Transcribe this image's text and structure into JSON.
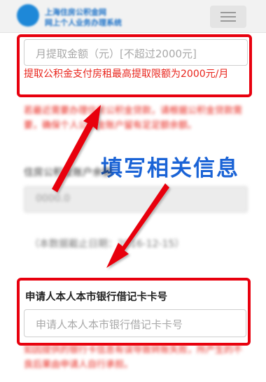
{
  "header": {
    "title_line1": "上海住房公积金网",
    "title_line2": "网上个人业务办理系统"
  },
  "monthly_amount": {
    "placeholder": "月提取金额（元）[不超过2000元]",
    "note": "提取公积金支付房租最高提取限额为2000元/月"
  },
  "blurred_warning": "若最近需要办理住房公积金贷款，请根据公积金贷款需要，确保个人公积金账户留有足足额余额。",
  "callout_text": "填写相关信息",
  "account_label": "住房公积金账户余额",
  "account_value": "0000.0",
  "account_date": "（本数据截止日期：2016-12-15）",
  "bank_card": {
    "label": "申请人本人本市银行借记卡卡号",
    "placeholder": "申请人本人本市银行借记卡卡号"
  },
  "bottom_warning": "如因提供的银行卡信息有误导致转账失败，所产生的不良后果由申请人自行承担。",
  "colors": {
    "highlight": "#e8000e",
    "callout": "#1a63d6",
    "note_red": "#e8231a"
  },
  "icons": [
    "logo-icon",
    "menu-icon",
    "arrow-icon"
  ]
}
